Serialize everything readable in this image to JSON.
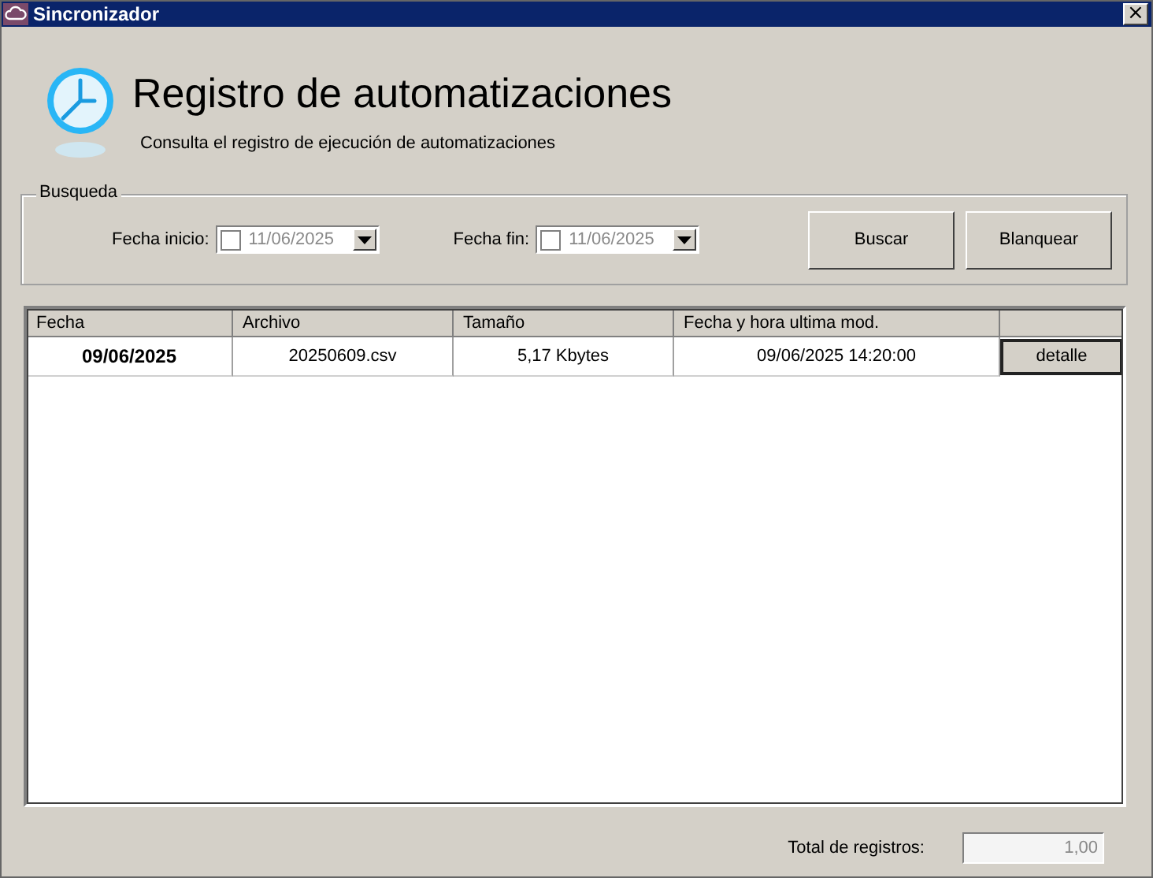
{
  "window": {
    "title": "Sincronizador",
    "close": "×"
  },
  "header": {
    "title": "Registro de automatizaciones",
    "subtitle": "Consulta el registro de ejecución de automatizaciones"
  },
  "search": {
    "legend": "Busqueda",
    "fields": [
      {
        "label": "Fecha inicio:",
        "value": "11/06/2025",
        "checked": false,
        "disabled": true
      },
      {
        "label": "Fecha fin:",
        "value": "11/06/2025",
        "checked": false,
        "disabled": true
      }
    ],
    "buttons": [
      "Buscar",
      "Blanquear"
    ]
  },
  "table": {
    "columns": [
      "Fecha",
      "Archivo",
      "Tamaño",
      "Fecha y hora ultima mod."
    ],
    "rows": [
      {
        "cells": [
          "09/06/2025",
          "20250609.csv",
          "5,17 Kbytes",
          "09/06/2025 14:20:00"
        ],
        "action": "detalle"
      }
    ]
  },
  "footer": {
    "label": "Total de registros:",
    "value": "1,00"
  }
}
